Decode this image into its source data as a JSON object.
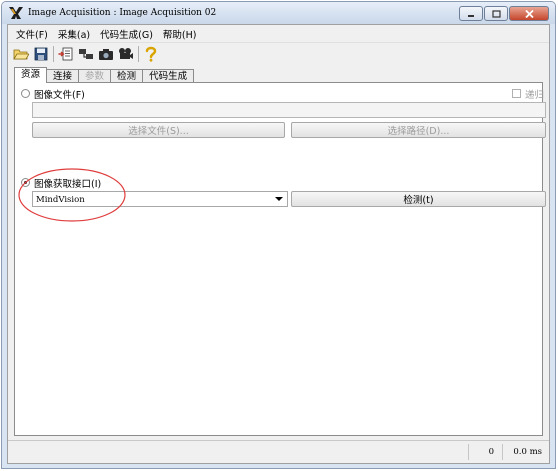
{
  "window": {
    "title": "Image Acquisition : Image Acquisition 02"
  },
  "menu": [
    "文件(F)",
    "采集(a)",
    "代码生成(G)",
    "帮助(H)"
  ],
  "toolbar": [
    "open-folder-icon",
    "save-icon",
    "export-icon",
    "connect-icon",
    "snapshot-icon",
    "live-video-icon",
    "help-icon"
  ],
  "tabs": [
    {
      "label": "资源",
      "active": true,
      "disabled": false
    },
    {
      "label": "连接",
      "active": false,
      "disabled": false
    },
    {
      "label": "参数",
      "active": false,
      "disabled": true
    },
    {
      "label": "检测",
      "active": false,
      "disabled": false
    },
    {
      "label": "代码生成",
      "active": false,
      "disabled": false
    }
  ],
  "source": {
    "image_files_label": "图像文件(F)",
    "recursive_label": "递归",
    "path_value": "",
    "select_file_button": "选择文件(S)...",
    "select_path_button": "选择路径(D)...",
    "interface_label": "图像获取接口(I)",
    "interface_value": "MindVision",
    "detect_button": "检测(t)"
  },
  "status": {
    "count": "0",
    "time": "0.0 ms"
  },
  "colors": {
    "annotation_circle": "#e03c3c"
  }
}
